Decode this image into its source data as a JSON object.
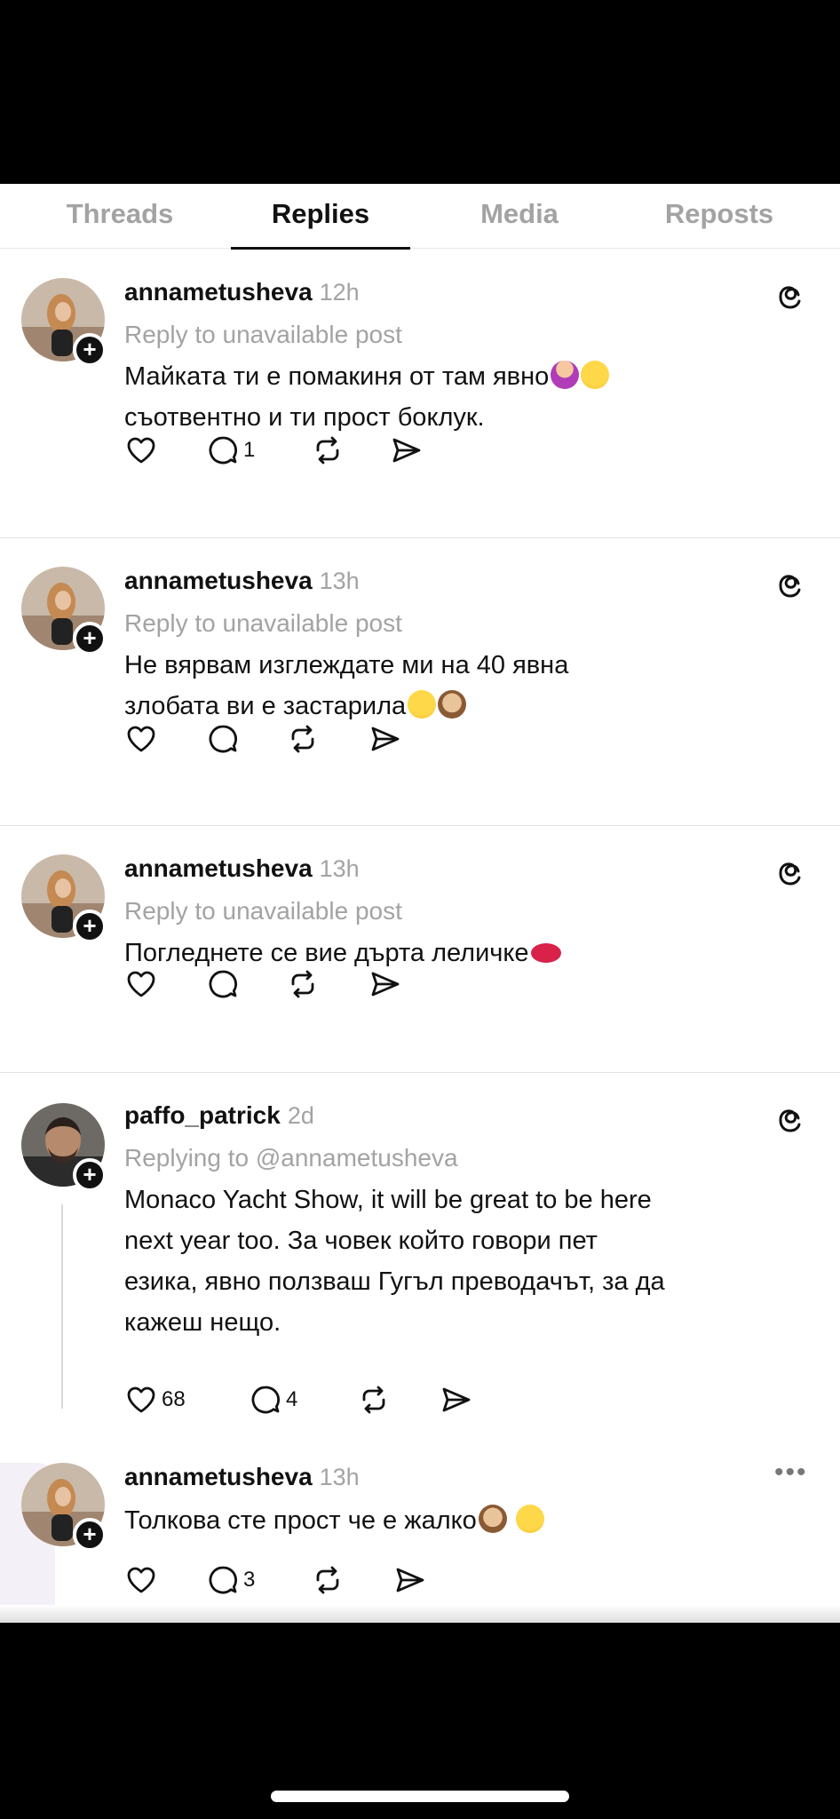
{
  "tabs": [
    {
      "label": "Threads",
      "active": false
    },
    {
      "label": "Replies",
      "active": true
    },
    {
      "label": "Media",
      "active": false
    },
    {
      "label": "Reposts",
      "active": false
    }
  ],
  "posts": [
    {
      "username": "annametusheva",
      "time": "12h",
      "reply_to": "Reply to unavailable post",
      "lines": [
        "Майката ти е помакиня от там явно",
        "съотвентно и ти прост боклук."
      ],
      "emoji_line1": [
        "shrug",
        "laugh"
      ],
      "likes": "",
      "comments": "1",
      "menu_icon": "threads-icon"
    },
    {
      "username": "annametusheva",
      "time": "13h",
      "reply_to": "Reply to unavailable post",
      "lines": [
        "Не вярвам изглеждате ми на 40 явна",
        "злобата ви е застарила"
      ],
      "emoji_line2": [
        "grin",
        "monkey"
      ],
      "likes": "",
      "comments": "",
      "menu_icon": "threads-icon"
    },
    {
      "username": "annametusheva",
      "time": "13h",
      "reply_to": "Reply to unavailable post",
      "lines": [
        "Погледнете се вие дърта леличке"
      ],
      "emoji_line1": [
        "kiss"
      ],
      "likes": "",
      "comments": "",
      "menu_icon": "threads-icon"
    },
    {
      "username": "paffo_patrick",
      "time": "2d",
      "reply_to": "Replying to @annametusheva",
      "lines": [
        "Monaco Yacht Show, it will be great to be here",
        "next year too. За човек който говори пет",
        "езика, явно ползваш Гугъл преводачът, за да",
        "кажеш нещо."
      ],
      "likes": "68",
      "comments": "4",
      "menu_icon": "threads-icon"
    },
    {
      "username": "annametusheva",
      "time": "13h",
      "reply_to": "",
      "lines": [
        "Толкова сте прост че е жалко"
      ],
      "emoji_line1": [
        "monkey",
        "grin"
      ],
      "likes": "",
      "comments": "3",
      "menu_icon": "more-icon"
    }
  ],
  "icons": {
    "like": "heart-icon",
    "comment": "comment-icon",
    "repost": "repost-icon",
    "share": "share-icon",
    "follow": "plus-icon"
  },
  "colors": {
    "text": "#111111",
    "muted": "#a3a3a3",
    "divider": "#e3e3e3",
    "background": "#ffffff"
  }
}
